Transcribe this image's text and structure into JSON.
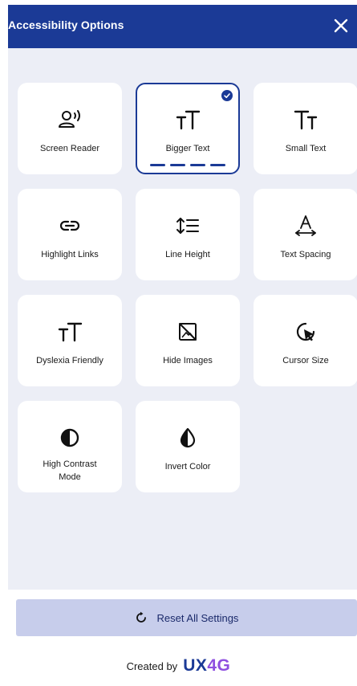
{
  "header": {
    "title": "Accessibility Options",
    "close_icon": "close-icon"
  },
  "options": [
    {
      "label": "Screen Reader",
      "icon": "screen-reader-icon",
      "selected": false
    },
    {
      "label": "Bigger Text",
      "icon": "bigger-text-icon",
      "selected": true,
      "level": 4,
      "level_max": 4
    },
    {
      "label": "Small Text",
      "icon": "small-text-icon",
      "selected": false
    },
    {
      "label": "Highlight Links",
      "icon": "link-icon",
      "selected": false
    },
    {
      "label": "Line Height",
      "icon": "line-height-icon",
      "selected": false
    },
    {
      "label": "Text Spacing",
      "icon": "text-spacing-icon",
      "selected": false
    },
    {
      "label": "Dyslexia Friendly",
      "icon": "dyslexia-font-icon",
      "selected": false
    },
    {
      "label": "Hide Images",
      "icon": "hide-images-icon",
      "selected": false
    },
    {
      "label": "Cursor Size",
      "icon": "cursor-icon",
      "selected": false
    },
    {
      "label": "High Contrast Mode",
      "icon": "contrast-icon",
      "selected": false
    },
    {
      "label": "Invert Color",
      "icon": "invert-color-icon",
      "selected": false
    }
  ],
  "reset": {
    "label": "Reset All Settings",
    "icon": "reset-icon"
  },
  "footer": {
    "created_by": "Created by",
    "brand_part1": "UX",
    "brand_part2": "4G"
  },
  "colors": {
    "primary": "#1b3a96",
    "panel_bg": "#eceef6",
    "reset_bg": "#c7cdeb",
    "brand_accent": "#8f4fe0"
  }
}
